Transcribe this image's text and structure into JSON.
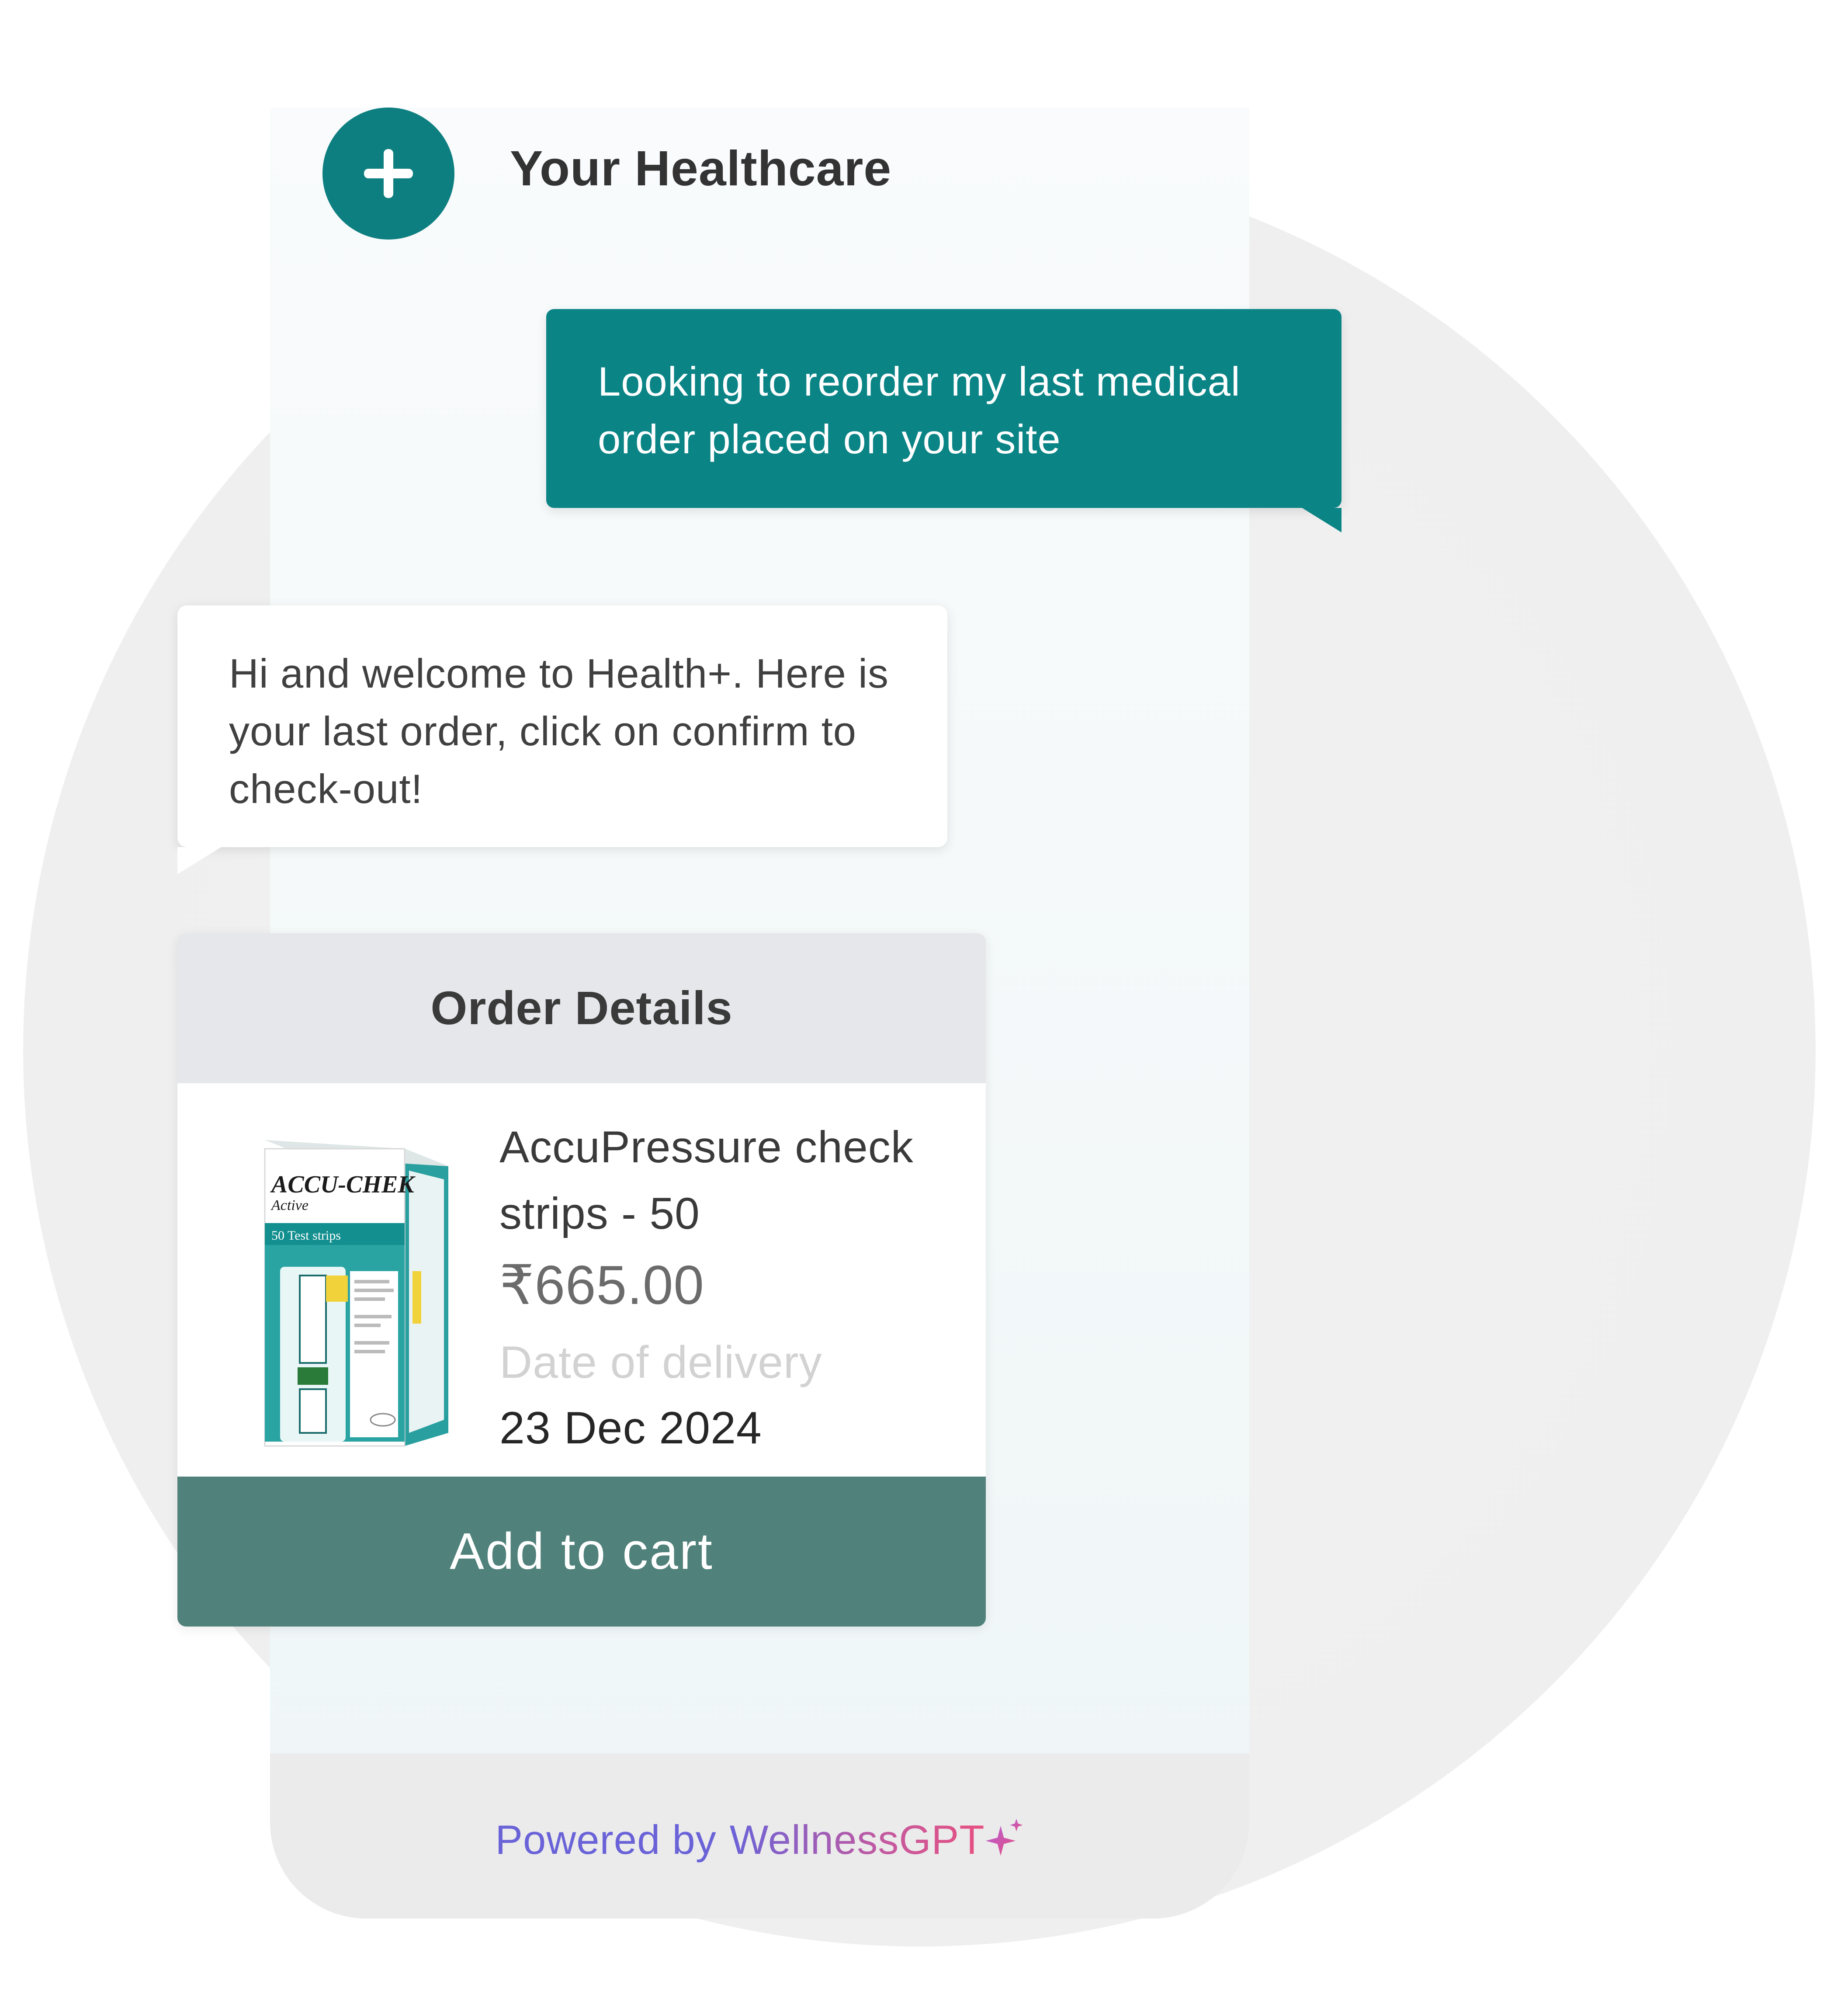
{
  "header": {
    "title": "Your Healthcare",
    "logo_icon": "plus-icon"
  },
  "messages": [
    {
      "role": "user",
      "text": "Looking to reorder my last medical order placed on your site"
    },
    {
      "role": "bot",
      "text": "Hi and welcome to Health+. Here is your last order, click on confirm to check-out!"
    }
  ],
  "order": {
    "title": "Order Details",
    "product_name": "AccuPressure check strips - 50",
    "price": "₹665.00",
    "delivery_label": "Date of delivery",
    "delivery_date": "23 Dec 2024",
    "add_to_cart_label": "Add to cart",
    "image_brand": "ACCU-CHEK",
    "image_sub": "Active",
    "image_strip": "50 Test strips"
  },
  "footer": {
    "powered_by": "Powered by",
    "brand": "WellnessGPT",
    "brand_icon": "sparkle-icon"
  },
  "colors": {
    "teal": "#0b8486",
    "cart_button": "#50817a",
    "powered_by": "#6a63d8",
    "brand_end": "#e84f7f"
  }
}
